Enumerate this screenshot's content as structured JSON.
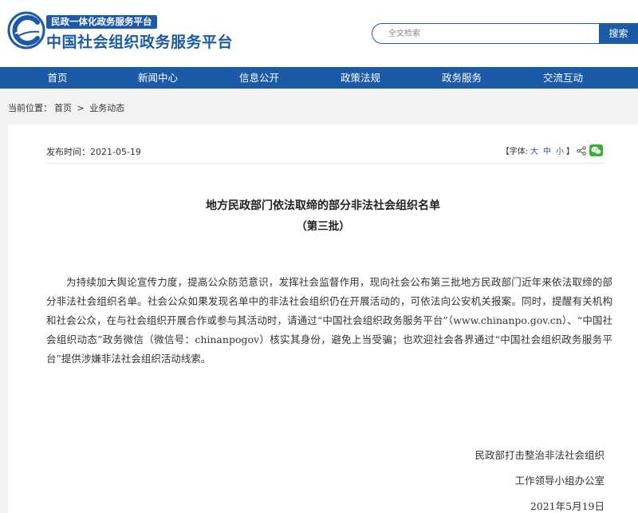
{
  "header": {
    "badge": "民政一体化政务服务平台",
    "site_title": "中国社会组织政务服务平台",
    "search_placeholder": "全文检索",
    "search_button": "搜索",
    "colors": {
      "brand": "#1b5aa7"
    }
  },
  "nav": {
    "items": [
      {
        "label": "首页"
      },
      {
        "label": "新闻中心"
      },
      {
        "label": "信息公开"
      },
      {
        "label": "政策法规"
      },
      {
        "label": "政务服务"
      },
      {
        "label": "交流互动"
      }
    ]
  },
  "breadcrumb": {
    "label": "当前位置：",
    "home": "首页",
    "separator": ">",
    "current": "业务动态"
  },
  "article": {
    "pubdate": "发布时间：2021-05-19",
    "font_label": "【字体:",
    "font_large": "大",
    "font_medium": "中",
    "font_small": "小",
    "font_close": "】",
    "title": "地方民政部门依法取缔的部分非法社会组织名单",
    "subtitle": "（第三批）",
    "body": "为持续加大舆论宣传力度，提高公众防范意识，发挥社会监督作用，现向社会公布第三批地方民政部门近年来依法取缔的部分非法社会组织名单。社会公众如果发现名单中的非法社会组织仍在开展活动的，可依法向公安机关报案。同时，提醒有关机构和社会公众，在与社会组织开展合作或参与其活动时，请通过“中国社会组织政务服务平台”（www.chinanpo.gov.cn）、“中国社会组织动态”政务微信（微信号：chinanpogov）核实其身份，避免上当受骗；也欢迎社会各界通过“中国社会组织政务服务平台”提供涉嫌非法社会组织活动线索。",
    "signature_line1": "民政部打击整治非法社会组织",
    "signature_line2": "工作领导小组办公室",
    "signature_date": "2021年5月19日"
  }
}
